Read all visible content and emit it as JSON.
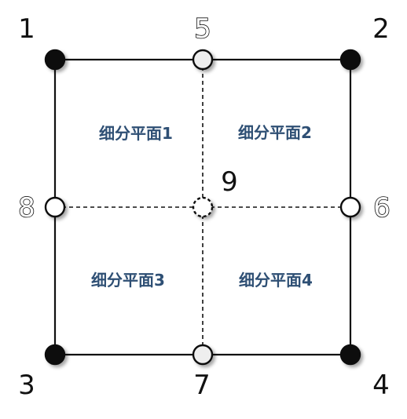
{
  "nodes": [
    {
      "id": "n1",
      "label": "1",
      "kind": "corner"
    },
    {
      "id": "n2",
      "label": "2",
      "kind": "corner"
    },
    {
      "id": "n3",
      "label": "3",
      "kind": "corner"
    },
    {
      "id": "n4",
      "label": "4",
      "kind": "corner"
    },
    {
      "id": "n5",
      "label": "5",
      "kind": "midside"
    },
    {
      "id": "n6",
      "label": "6",
      "kind": "midside"
    },
    {
      "id": "n7",
      "label": "7",
      "kind": "midside"
    },
    {
      "id": "n8",
      "label": "8",
      "kind": "midside"
    },
    {
      "id": "n9",
      "label": "9",
      "kind": "center"
    }
  ],
  "regions": [
    {
      "id": "r1",
      "label": "细分平面1"
    },
    {
      "id": "r2",
      "label": "细分平面2"
    },
    {
      "id": "r3",
      "label": "细分平面3"
    },
    {
      "id": "r4",
      "label": "细分平面4"
    }
  ],
  "colors": {
    "corner_fill": "#111111",
    "midside_fill": "#eeeeee",
    "center_fill": "#ffffff",
    "edge": "#111111",
    "label": "#2e4f74"
  }
}
